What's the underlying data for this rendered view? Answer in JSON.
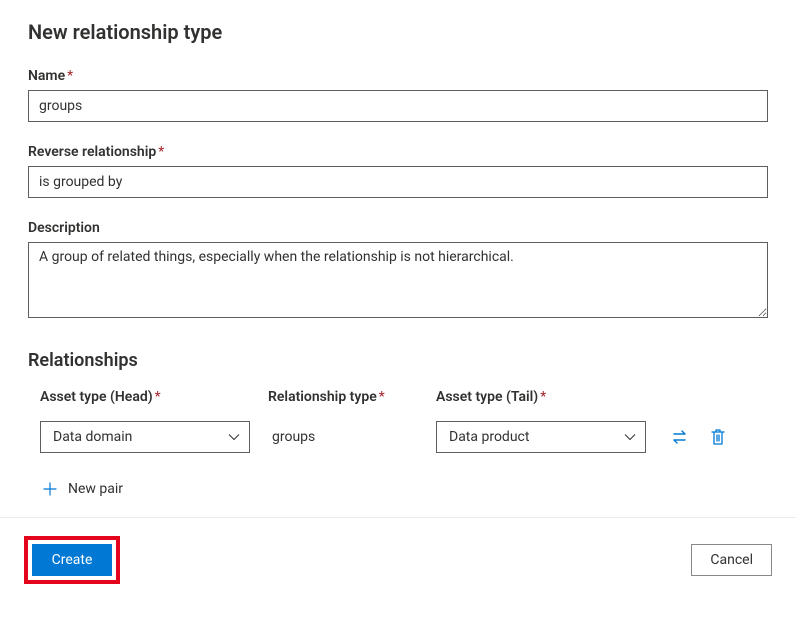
{
  "title": "New relationship type",
  "fields": {
    "name": {
      "label": "Name",
      "value": "groups",
      "required": true
    },
    "reverse": {
      "label": "Reverse relationship",
      "value": "is grouped by",
      "required": true
    },
    "description": {
      "label": "Description",
      "value": "A group of related things, especially when the relationship is not hierarchical."
    }
  },
  "relationships": {
    "heading": "Relationships",
    "columns": {
      "head": "Asset type (Head)",
      "type": "Relationship type",
      "tail": "Asset type (Tail)"
    },
    "row": {
      "head_value": "Data domain",
      "type_value": "groups",
      "tail_value": "Data product"
    },
    "new_pair_label": "New pair"
  },
  "footer": {
    "create": "Create",
    "cancel": "Cancel"
  },
  "required_marker": "*"
}
